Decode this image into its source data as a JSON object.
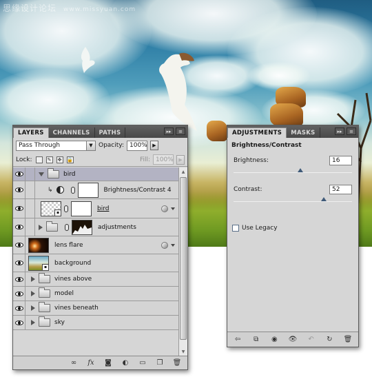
{
  "watermark": {
    "text": "思缘设计论坛",
    "url": "www.missyuan.com"
  },
  "layers_panel": {
    "tabs": [
      "LAYERS",
      "CHANNELS",
      "PATHS"
    ],
    "blend_mode": "Pass Through",
    "opacity_label": "Opacity:",
    "opacity_value": "100%",
    "lock_label": "Lock:",
    "fill_label": "Fill:",
    "fill_value": "100%",
    "layers": [
      {
        "name": "bird",
        "kind": "group",
        "expanded": true,
        "selected": true
      },
      {
        "name": "Brightness/Contrast 4",
        "kind": "adjustment",
        "clipped": true
      },
      {
        "name": "bird",
        "kind": "layer-mask",
        "has_fx": true
      },
      {
        "name": "adjustments",
        "kind": "group-mask",
        "expanded": false
      },
      {
        "name": "lens flare",
        "kind": "layer",
        "has_fx": true
      },
      {
        "name": "background",
        "kind": "layer"
      },
      {
        "name": "vines above",
        "kind": "group",
        "expanded": false
      },
      {
        "name": "model",
        "kind": "group",
        "expanded": false
      },
      {
        "name": "vines beneath",
        "kind": "group",
        "expanded": false
      },
      {
        "name": "sky",
        "kind": "group",
        "expanded": false
      }
    ],
    "bottom_icons": [
      "link-icon",
      "fx-icon",
      "mask-icon",
      "adjustment-icon",
      "new-group-icon",
      "new-layer-icon",
      "trash-icon"
    ]
  },
  "adjustments_panel": {
    "tabs": [
      "ADJUSTMENTS",
      "MASKS"
    ],
    "title": "Brightness/Contrast",
    "brightness_label": "Brightness:",
    "brightness_value": "16",
    "brightness_fraction": 0.565,
    "contrast_label": "Contrast:",
    "contrast_value": "52",
    "contrast_fraction": 0.76,
    "use_legacy_label": "Use Legacy",
    "use_legacy_checked": false,
    "bottom_icons": [
      "back-arrow-icon",
      "clip-icon",
      "view-previous-icon",
      "visibility-icon",
      "reset-icon",
      "refresh-icon",
      "trash-icon"
    ]
  }
}
